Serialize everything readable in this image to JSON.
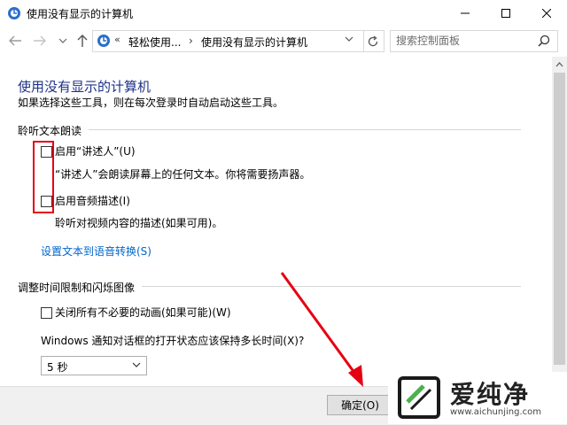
{
  "window": {
    "title": "使用没有显示的计算机"
  },
  "address": {
    "chev_left": "«",
    "crumb1": "轻松使用...",
    "sep": "›",
    "crumb2": "使用没有显示的计算机",
    "search_placeholder": "搜索控制面板"
  },
  "page": {
    "title": "使用没有显示的计算机",
    "subtitle": "如果选择这些工具，则在每次登录时自动启动这些工具。"
  },
  "section1": {
    "heading": "聆听文本朗读",
    "narrator_label": "启用“讲述人”(U)",
    "narrator_desc": "“讲述人”会朗读屏幕上的任何文本。你将需要扬声器。",
    "audio_label": "启用音频描述(I)",
    "audio_desc": "聆听对视频内容的描述(如果可用)。",
    "tts_link": "设置文本到语音转换(S)"
  },
  "section2": {
    "heading": "调整时间限制和闪烁图像",
    "animations_label": "关闭所有不必要的动画(如果可能)(W)",
    "notify_label": "Windows 通知对话框的打开状态应该保持多长时间(X)?",
    "notify_value": "5 秒"
  },
  "footer": {
    "ok_label": "确定(O)"
  },
  "watermark": {
    "brand": "爱纯净",
    "url": "www.aichunjing.com"
  },
  "colors": {
    "title_blue": "#1e3287",
    "link_blue": "#0066cc",
    "annotation_red": "#e60012"
  }
}
